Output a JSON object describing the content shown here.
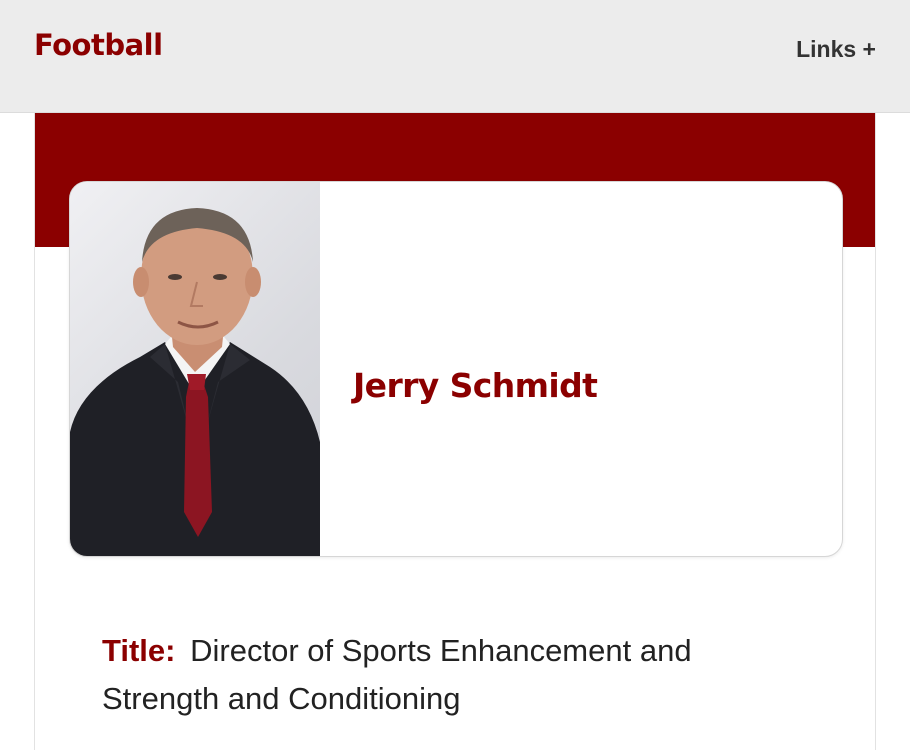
{
  "header": {
    "sport_title": "Football",
    "links_label": "Links +"
  },
  "colors": {
    "brand": "#8b0000",
    "header_bg": "#ececec"
  },
  "profile": {
    "name": "Jerry Schmidt",
    "photo_icon": "headshot-photo",
    "title_label": "Title:",
    "title_value": "Director of Sports Enhancement and Strength and Conditioning"
  }
}
